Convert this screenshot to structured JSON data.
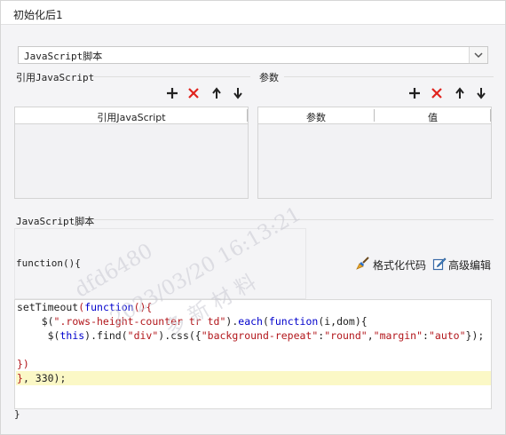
{
  "window": {
    "title": "初始化后1"
  },
  "script_type_select": {
    "value": "JavaScript脚本"
  },
  "ref_js_section": {
    "label": "引用JavaScript",
    "column": "引用JavaScript"
  },
  "params_section": {
    "label": "参数",
    "columns": [
      "参数",
      "值"
    ]
  },
  "script_section": {
    "label": "JavaScript脚本"
  },
  "code": {
    "head": "function(){",
    "footer": "}",
    "lines": [
      [
        {
          "t": "setTimeout",
          "c": ""
        },
        {
          "t": "(",
          "c": "br"
        },
        {
          "t": "function",
          "c": "kw"
        },
        {
          "t": "(){",
          "c": "br"
        }
      ],
      [
        {
          "t": "    $(",
          "c": ""
        },
        {
          "t": "\".rows-height-counter tr td\"",
          "c": "str"
        },
        {
          "t": ").",
          "c": ""
        },
        {
          "t": "each",
          "c": "kw"
        },
        {
          "t": "(",
          "c": ""
        },
        {
          "t": "function",
          "c": "kw"
        },
        {
          "t": "(i,dom){",
          "c": ""
        }
      ],
      [
        {
          "t": "     $(",
          "c": ""
        },
        {
          "t": "this",
          "c": "kw"
        },
        {
          "t": ").find(",
          "c": ""
        },
        {
          "t": "\"div\"",
          "c": "str"
        },
        {
          "t": ").css({",
          "c": ""
        },
        {
          "t": "\"background-repeat\"",
          "c": "str"
        },
        {
          "t": ":",
          "c": ""
        },
        {
          "t": "\"round\"",
          "c": "str"
        },
        {
          "t": ",",
          "c": ""
        },
        {
          "t": "\"margin\"",
          "c": "str"
        },
        {
          "t": ":",
          "c": ""
        },
        {
          "t": "\"auto\"",
          "c": "str"
        },
        {
          "t": "});",
          "c": ""
        }
      ],
      [
        {
          "t": "",
          "c": ""
        }
      ],
      [
        {
          "t": "})",
          "c": "br"
        }
      ],
      [
        {
          "t": "}",
          "c": "br"
        },
        {
          "t": ", 330);",
          "c": ""
        }
      ]
    ]
  },
  "actions": {
    "format_code": "格式化代码",
    "advanced_edit": "高级编辑"
  },
  "watermark": {
    "line1": "dfd6480",
    "line2": "2023/03/20  16:13:21",
    "line3": "多 新 材 料"
  },
  "colors": {
    "delete": "#e0231d",
    "code_keyword": "#0000cc",
    "code_string": "#b2161b",
    "highlight": "#fbf8c6"
  }
}
